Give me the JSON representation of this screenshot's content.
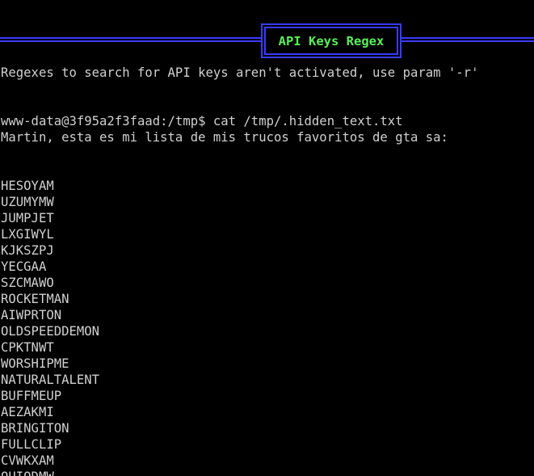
{
  "banner": {
    "title": "API Keys Regex"
  },
  "lines": {
    "notice": "Regexes to search for API keys aren't activated, use param '-r'",
    "command": "www-data@3f95a2f3faad:/tmp$ cat /tmp/.hidden_text.txt",
    "intro": "Martin, esta es mi lista de mis trucos favoritos de gta sa:"
  },
  "cheats": [
    "HESOYAM",
    "UZUMYMW",
    "JUMPJET",
    "LXGIWYL",
    "KJKSZPJ",
    "YECGAA",
    "SZCMAWO",
    "ROCKETMAN",
    "AIWPRTON",
    "OLDSPEEDDEMON",
    "CPKTNWT",
    "WORSHIPME",
    "NATURALTALENT",
    "BUFFMEUP",
    "AEZAKMI",
    "BRINGITON",
    "FULLCLIP",
    "CVWKXAM",
    "OUIQDMW"
  ],
  "colors": {
    "background": "#000000",
    "text": "#d0d0d0",
    "banner_border": "#3a3aff",
    "banner_text": "#59f059"
  }
}
